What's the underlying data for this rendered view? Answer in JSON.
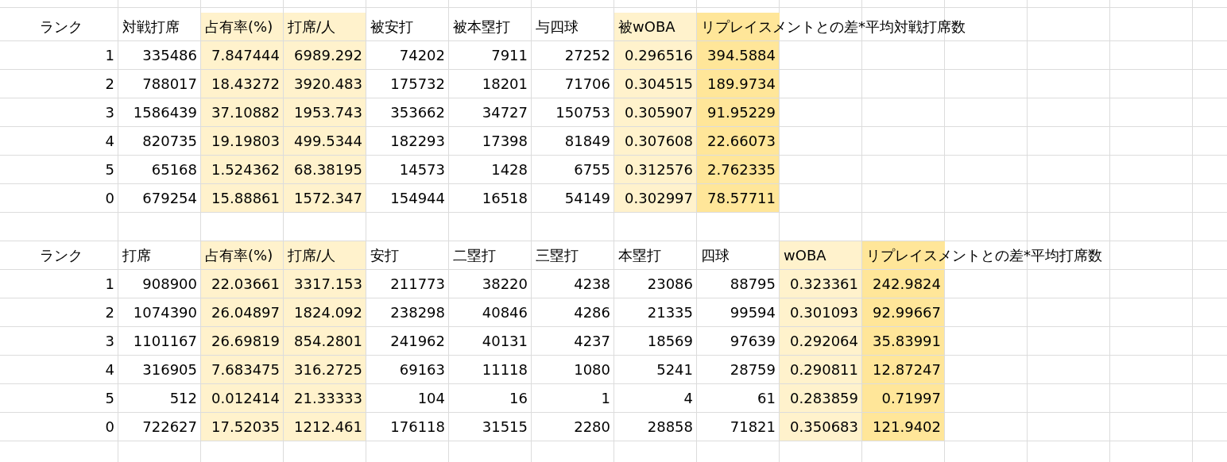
{
  "tables": [
    {
      "columns": [
        {
          "label": "ランク"
        },
        {
          "label": "対戦打席"
        },
        {
          "label": "占有率(%)",
          "color": "#fff2cc"
        },
        {
          "label": "打席/人",
          "color": "#fff2cc"
        },
        {
          "label": "被安打"
        },
        {
          "label": "被本塁打"
        },
        {
          "label": "与四球"
        },
        {
          "label": "被wOBA",
          "color": "#fff2cc"
        },
        {
          "label": "リプレイスメントとの差*平均対戦打席数",
          "color": "#ffe699"
        }
      ],
      "rows": [
        [
          "1",
          "335486",
          "7.847444",
          "6989.292",
          "74202",
          "7911",
          "27252",
          "0.296516",
          "394.5884"
        ],
        [
          "2",
          "788017",
          "18.43272",
          "3920.483",
          "175732",
          "18201",
          "71706",
          "0.304515",
          "189.9734"
        ],
        [
          "3",
          "1586439",
          "37.10882",
          "1953.743",
          "353662",
          "34727",
          "150753",
          "0.305907",
          "91.95229"
        ],
        [
          "4",
          "820735",
          "19.19803",
          "499.5344",
          "182293",
          "17398",
          "81849",
          "0.307608",
          "22.66073"
        ],
        [
          "5",
          "65168",
          "1.524362",
          "68.38195",
          "14573",
          "1428",
          "6755",
          "0.312576",
          "2.762335"
        ],
        [
          "0",
          "679254",
          "15.88861",
          "1572.347",
          "154944",
          "16518",
          "54149",
          "0.302997",
          "78.57711"
        ]
      ]
    },
    {
      "columns": [
        {
          "label": "ランク"
        },
        {
          "label": "打席"
        },
        {
          "label": "占有率(%)",
          "color": "#fff2cc"
        },
        {
          "label": "打席/人",
          "color": "#fff2cc"
        },
        {
          "label": "安打"
        },
        {
          "label": "二塁打"
        },
        {
          "label": "三塁打"
        },
        {
          "label": "本塁打"
        },
        {
          "label": "四球"
        },
        {
          "label": "wOBA",
          "color": "#fff2cc"
        },
        {
          "label": "リプレイスメントとの差*平均打席数",
          "color": "#ffe699"
        }
      ],
      "rows": [
        [
          "1",
          "908900",
          "22.03661",
          "3317.153",
          "211773",
          "38220",
          "4238",
          "23086",
          "88795",
          "0.323361",
          "242.9824"
        ],
        [
          "2",
          "1074390",
          "26.04897",
          "1824.092",
          "238298",
          "40846",
          "4286",
          "21335",
          "99594",
          "0.301093",
          "92.99667"
        ],
        [
          "3",
          "1101167",
          "26.69819",
          "854.2801",
          "241962",
          "40131",
          "4237",
          "18569",
          "97639",
          "0.292064",
          "35.83991"
        ],
        [
          "4",
          "316905",
          "7.683475",
          "316.2725",
          "69163",
          "11118",
          "1080",
          "5241",
          "28759",
          "0.290811",
          "12.87247"
        ],
        [
          "5",
          "512",
          "0.012414",
          "21.33333",
          "104",
          "16",
          "1",
          "4",
          "61",
          "0.283859",
          "0.71997"
        ],
        [
          "0",
          "722627",
          "17.52035",
          "1212.461",
          "176118",
          "31515",
          "2280",
          "28858",
          "71821",
          "0.350683",
          "121.9402"
        ]
      ]
    }
  ]
}
